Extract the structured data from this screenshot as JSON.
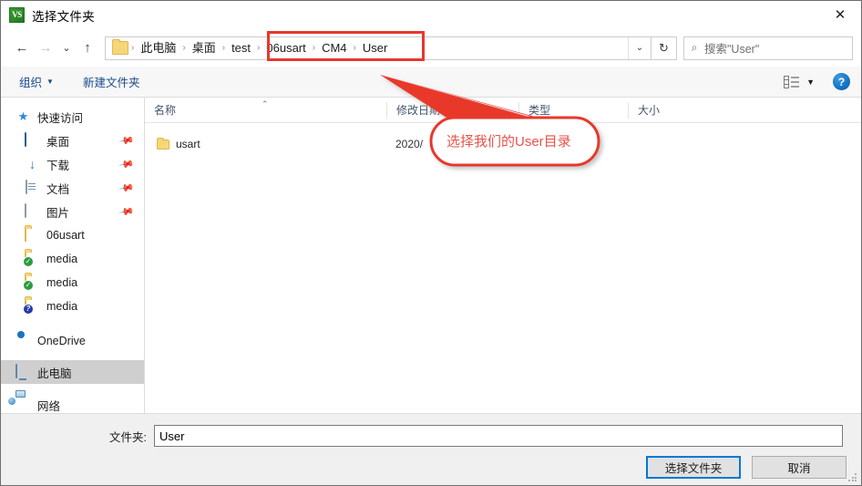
{
  "window": {
    "title": "选择文件夹",
    "icon": "vs-app-icon",
    "icon_text": "VS",
    "close_label": "✕"
  },
  "navbar": {
    "back_icon": "back-arrow-icon",
    "back_glyph": "←",
    "forward_icon": "forward-arrow-icon",
    "forward_glyph": "→",
    "recent_icon": "chevron-down-icon",
    "recent_glyph": "⌄",
    "up_icon": "up-arrow-icon",
    "up_glyph": "↑",
    "breadcrumbs": [
      {
        "label": "此电脑",
        "highlighted": false
      },
      {
        "label": "桌面",
        "highlighted": false
      },
      {
        "label": "test",
        "highlighted": false
      },
      {
        "label": "06usart",
        "highlighted": true
      },
      {
        "label": "CM4",
        "highlighted": true
      },
      {
        "label": "User",
        "highlighted": true
      }
    ],
    "separator": "›",
    "dropdown_glyph": "⌄",
    "refresh_glyph": "↻",
    "search": {
      "placeholder": "搜索\"User\"",
      "icon": "search-icon",
      "icon_glyph": "⌕",
      "value": ""
    }
  },
  "commandbar": {
    "organize_label": "组织",
    "organize_caret": "▼",
    "new_folder_label": "新建文件夹",
    "view_caret": "▼",
    "help_label": "?"
  },
  "sidebar": {
    "items": [
      {
        "label": "快速访问",
        "icon": "star-pin-icon",
        "level": 0,
        "pinned": false,
        "selected": false
      },
      {
        "label": "桌面",
        "icon": "desktop-icon",
        "level": 1,
        "pinned": true,
        "selected": false
      },
      {
        "label": "下载",
        "icon": "downloads-icon",
        "level": 1,
        "pinned": true,
        "selected": false
      },
      {
        "label": "文档",
        "icon": "documents-icon",
        "level": 1,
        "pinned": true,
        "selected": false
      },
      {
        "label": "图片",
        "icon": "pictures-icon",
        "level": 1,
        "pinned": true,
        "selected": false
      },
      {
        "label": "06usart",
        "icon": "folder-icon",
        "level": 1,
        "pinned": false,
        "selected": false
      },
      {
        "label": "media",
        "icon": "folder-synced-icon",
        "level": 1,
        "pinned": false,
        "selected": false
      },
      {
        "label": "media",
        "icon": "folder-synced-icon",
        "level": 1,
        "pinned": false,
        "selected": false
      },
      {
        "label": "media",
        "icon": "folder-unknown-icon",
        "level": 1,
        "pinned": false,
        "selected": false
      },
      {
        "label": "OneDrive",
        "icon": "onedrive-icon",
        "level": 0,
        "pinned": false,
        "selected": false
      },
      {
        "label": "此电脑",
        "icon": "this-pc-icon",
        "level": 0,
        "pinned": false,
        "selected": true
      },
      {
        "label": "网络",
        "icon": "network-icon",
        "level": 0,
        "pinned": false,
        "selected": false
      }
    ]
  },
  "filelist": {
    "columns": [
      {
        "key": "name",
        "label": "名称",
        "sorted": true
      },
      {
        "key": "date",
        "label": "修改日期",
        "sorted": false
      },
      {
        "key": "type",
        "label": "类型",
        "sorted": false
      },
      {
        "key": "size",
        "label": "大小",
        "sorted": false
      }
    ],
    "sort_caret": "⌃",
    "rows": [
      {
        "name": "usart",
        "date": "2020/",
        "type": "",
        "size": "",
        "icon": "folder-icon"
      }
    ]
  },
  "footer": {
    "folder_label": "文件夹:",
    "folder_value": "User",
    "select_button": "选择文件夹",
    "cancel_button": "取消"
  },
  "annotations": {
    "callout_text": "选择我们的User目录",
    "highlight_color": "#e8372c",
    "callout_color": "#e8534a",
    "arrow_name": "annotation-arrow",
    "box_name": "breadcrumb-highlight-box"
  }
}
